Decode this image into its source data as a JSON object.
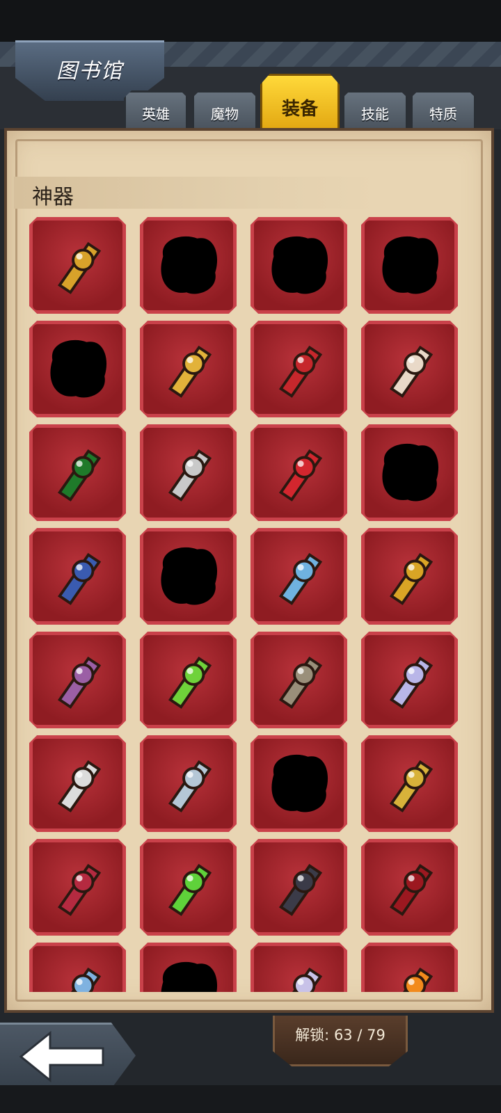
{
  "header": {
    "title": "图书馆"
  },
  "tabs": [
    {
      "label": "英雄",
      "active": false
    },
    {
      "label": "魔物",
      "active": false
    },
    {
      "label": "装备",
      "active": true
    },
    {
      "label": "技能",
      "active": false
    },
    {
      "label": "特质",
      "active": false
    }
  ],
  "section": {
    "title": "神器"
  },
  "footer": {
    "unlock_text": "解锁: 63 / 79"
  },
  "colors": {
    "accent": "#f2c21b",
    "cell_red": "#b8323a",
    "parchment": "#e8d5b3"
  },
  "items": [
    {
      "name": "golden-winged-mace-icon",
      "locked": false,
      "color": "#d8a22a"
    },
    {
      "name": "locked-item-silhouette-icon",
      "locked": true,
      "color": "#000000"
    },
    {
      "name": "locked-item-silhouette-icon",
      "locked": true,
      "color": "#000000"
    },
    {
      "name": "locked-item-silhouette-icon",
      "locked": true,
      "color": "#000000"
    },
    {
      "name": "locked-item-silhouette-icon",
      "locked": true,
      "color": "#000000"
    },
    {
      "name": "golden-hood-icon",
      "locked": false,
      "color": "#e2b23a"
    },
    {
      "name": "red-fur-cloak-icon",
      "locked": false,
      "color": "#c6272c"
    },
    {
      "name": "blue-robe-icon",
      "locked": false,
      "color": "#e9d9c8"
    },
    {
      "name": "green-dragon-armor-icon",
      "locked": false,
      "color": "#1f7a2a"
    },
    {
      "name": "silver-knight-helmet-icon",
      "locked": false,
      "color": "#c9c9c9"
    },
    {
      "name": "red-jeweled-book-icon",
      "locked": false,
      "color": "#d3262e"
    },
    {
      "name": "locked-item-silhouette-icon",
      "locked": true,
      "color": "#000000"
    },
    {
      "name": "jeweled-scepter-icon",
      "locked": false,
      "color": "#3a5bb0"
    },
    {
      "name": "locked-item-silhouette-icon",
      "locked": true,
      "color": "#000000"
    },
    {
      "name": "blue-claw-gauntlet-icon",
      "locked": false,
      "color": "#6fb2e0"
    },
    {
      "name": "golden-gauntlet-icon",
      "locked": false,
      "color": "#d9a425"
    },
    {
      "name": "purple-wizard-hat-icon",
      "locked": false,
      "color": "#9b5fa5"
    },
    {
      "name": "green-flame-scythe-icon",
      "locked": false,
      "color": "#6fd23a"
    },
    {
      "name": "stone-hammer-icon",
      "locked": false,
      "color": "#9a8f7a"
    },
    {
      "name": "crystal-sword-icon",
      "locked": false,
      "color": "#b9b6e8"
    },
    {
      "name": "green-aura-dagger-icon",
      "locked": false,
      "color": "#dcdcdc"
    },
    {
      "name": "skull-trident-icon",
      "locked": false,
      "color": "#b5c7d6"
    },
    {
      "name": "locked-item-silhouette-icon",
      "locked": true,
      "color": "#000000"
    },
    {
      "name": "lightning-spear-icon",
      "locked": false,
      "color": "#d8b23a"
    },
    {
      "name": "crimson-battle-axe-icon",
      "locked": false,
      "color": "#b52a40"
    },
    {
      "name": "green-glowing-blade-icon",
      "locked": false,
      "color": "#5fd23a"
    },
    {
      "name": "shadow-curved-blade-icon",
      "locked": false,
      "color": "#3b3b48"
    },
    {
      "name": "blood-red-sword-icon",
      "locked": false,
      "color": "#9c1820"
    },
    {
      "name": "blue-flower-staff-icon",
      "locked": false,
      "color": "#7fb2e0"
    },
    {
      "name": "locked-item-silhouette-icon",
      "locked": true,
      "color": "#000000"
    },
    {
      "name": "crystal-cluster-icon",
      "locked": false,
      "color": "#c8c2e8"
    },
    {
      "name": "fire-orb-icon",
      "locked": false,
      "color": "#f28a1c"
    }
  ]
}
